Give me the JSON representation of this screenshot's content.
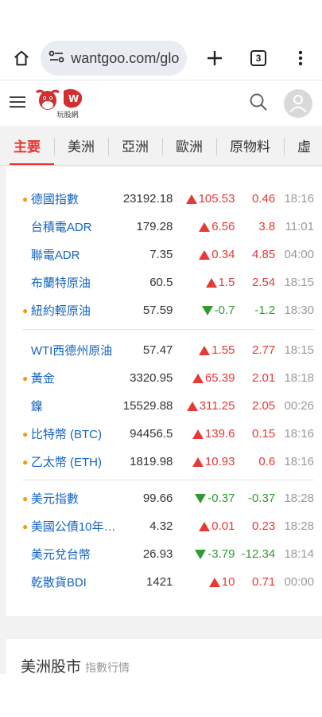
{
  "browser": {
    "url": "wantgoo.com/glo",
    "tab_count": "3",
    "icons": [
      "home-icon",
      "site-info-icon",
      "new-tab-icon",
      "tab-switcher-icon",
      "more-icon"
    ]
  },
  "site": {
    "logo_text": "玩股網",
    "icons": [
      "menu-icon",
      "search-icon",
      "user-icon"
    ]
  },
  "tabs": [
    {
      "label": "主要",
      "active": true
    },
    {
      "label": "美洲"
    },
    {
      "label": "亞洲"
    },
    {
      "label": "歐洲"
    },
    {
      "label": "原物料"
    },
    {
      "label": "虛"
    }
  ],
  "groups": [
    {
      "rows": [
        {
          "dot": true,
          "name": "德國指數",
          "price": "23192.18",
          "dir": "up",
          "change": "105.53",
          "pct": "0.46",
          "time": "18:16"
        },
        {
          "dot": false,
          "name": "台積電ADR",
          "price": "179.28",
          "dir": "up",
          "change": "6.56",
          "pct": "3.8",
          "time": "11:01"
        },
        {
          "dot": false,
          "name": "聯電ADR",
          "price": "7.35",
          "dir": "up",
          "change": "0.34",
          "pct": "4.85",
          "time": "04:00"
        },
        {
          "dot": false,
          "name": "布蘭特原油",
          "price": "60.5",
          "dir": "up",
          "change": "1.5",
          "pct": "2.54",
          "time": "18:15"
        },
        {
          "dot": true,
          "name": "紐約輕原油",
          "price": "57.59",
          "dir": "down",
          "change": "-0.7",
          "pct": "-1.2",
          "time": "18:30"
        }
      ]
    },
    {
      "rows": [
        {
          "dot": false,
          "name": "WTI西德州原油",
          "price": "57.47",
          "dir": "up",
          "change": "1.55",
          "pct": "2.77",
          "time": "18:15"
        },
        {
          "dot": true,
          "name": "黃金",
          "price": "3320.95",
          "dir": "up",
          "change": "65.39",
          "pct": "2.01",
          "time": "18:18"
        },
        {
          "dot": false,
          "name": "鎳",
          "price": "15529.88",
          "dir": "up",
          "change": "311.25",
          "pct": "2.05",
          "time": "00:26"
        },
        {
          "dot": true,
          "name": "比特幣 (BTC)",
          "price": "94456.5",
          "dir": "up",
          "change": "139.6",
          "pct": "0.15",
          "time": "18:16"
        },
        {
          "dot": true,
          "name": "乙太幣 (ETH)",
          "price": "1819.98",
          "dir": "up",
          "change": "10.93",
          "pct": "0.6",
          "time": "18:16"
        }
      ]
    },
    {
      "rows": [
        {
          "dot": true,
          "name": "美元指數",
          "price": "99.66",
          "dir": "down",
          "change": "-0.37",
          "pct": "-0.37",
          "time": "18:28"
        },
        {
          "dot": true,
          "name": "美國公債10年…",
          "price": "4.32",
          "dir": "up",
          "change": "0.01",
          "pct": "0.23",
          "time": "18:28"
        },
        {
          "dot": false,
          "name": "美元兌台幣",
          "price": "26.93",
          "dir": "down",
          "change": "-3.79",
          "pct": "-12.34",
          "time": "18:14"
        },
        {
          "dot": false,
          "name": "乾散貨BDI",
          "price": "1421",
          "dir": "up",
          "change": "10",
          "pct": "0.71",
          "time": "00:00"
        }
      ]
    }
  ],
  "section": {
    "title": "美洲股市",
    "subtitle": "指數行情"
  },
  "colors": {
    "accent": "#e8342f",
    "up": "#e53935",
    "down": "#2e9c2e",
    "link": "#1565c0",
    "dot": "#f39c12"
  }
}
